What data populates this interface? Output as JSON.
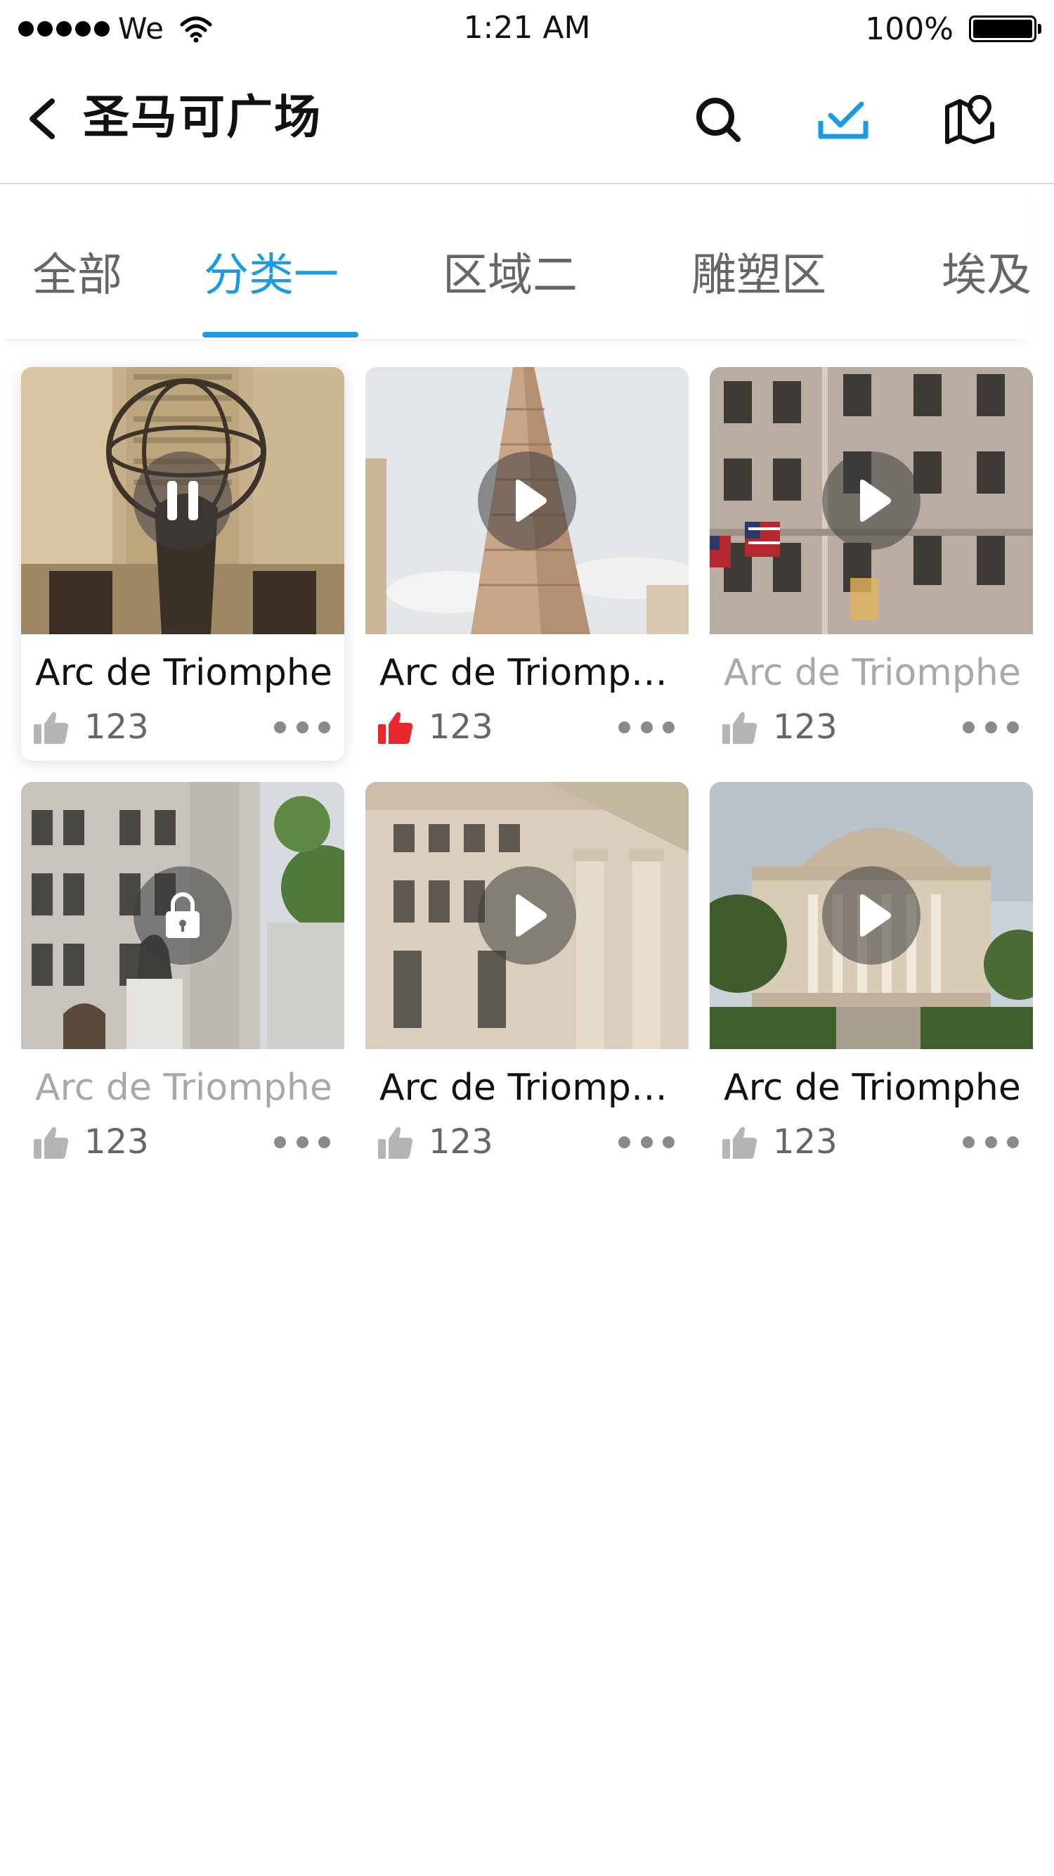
{
  "status_bar": {
    "carrier": "We",
    "time": "1:21 AM",
    "battery": "100%"
  },
  "nav": {
    "title": "圣马可广场"
  },
  "tabs": [
    {
      "label": "全部"
    },
    {
      "label": "分类一"
    },
    {
      "label": "区域二"
    },
    {
      "label": "雕塑区"
    },
    {
      "label": "埃及馆"
    }
  ],
  "active_tab": "分类一",
  "colors": {
    "accent": "#1a9be6",
    "liked": "#e8262d",
    "text_dim": "#a8a8a8"
  },
  "items": [
    {
      "title": "Arc de Triomphe",
      "likes": "123",
      "state": "pause-icon",
      "liked": false,
      "dim": false
    },
    {
      "title": "Arc de Triompheeee",
      "likes": "123",
      "state": "play-icon",
      "liked": true,
      "dim": false
    },
    {
      "title": "Arc de Triomphe",
      "likes": "123",
      "state": "play-icon",
      "liked": false,
      "dim": true
    },
    {
      "title": "Arc de Triomphe",
      "likes": "123",
      "state": "lock-icon",
      "liked": false,
      "dim": true
    },
    {
      "title": "Arc de Triompheeee",
      "likes": "123",
      "state": "play-icon",
      "liked": false,
      "dim": false
    },
    {
      "title": "Arc de Triomphe",
      "likes": "123",
      "state": "play-icon",
      "liked": false,
      "dim": false
    }
  ]
}
